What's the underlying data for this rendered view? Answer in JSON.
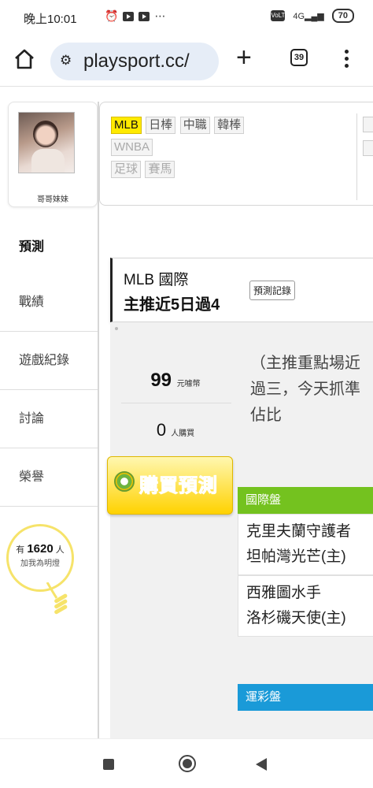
{
  "status_bar": {
    "time": "晚上10:01",
    "extra": "⋯",
    "volte": "VoLTE",
    "network": "4G",
    "battery": "70"
  },
  "browser": {
    "url": "playsport.cc/",
    "tab_count": "39"
  },
  "profile": {
    "name": "哥哥妹妹"
  },
  "leagues": {
    "tags": [
      "MLB",
      "日棒",
      "中職",
      "韓棒"
    ],
    "tags_row2": [
      "WNBA"
    ],
    "tags_row3": [
      "足球",
      "賽馬"
    ],
    "active": "MLB"
  },
  "nav": {
    "items": [
      "預測",
      "戰績",
      "遊戲紀錄",
      "討論",
      "榮譽"
    ]
  },
  "lamp": {
    "prefix": "有",
    "count": "1620",
    "suffix": "人",
    "subtitle": "加我為明燈"
  },
  "prediction": {
    "line1": "MLB 國際",
    "line2": "主推近5日過4",
    "record_button": "預測記錄",
    "price": "99",
    "price_unit": "元噱幣",
    "buyers": "0",
    "buyers_unit": "人購買",
    "buy_button": "購買預測",
    "buy_icon": "coin-icon",
    "analysis": [
      "（主推重點場近",
      "過三，今天抓準",
      "佔比"
    ]
  },
  "table": {
    "international_label": "國際盤",
    "games": [
      {
        "line1": "克里夫蘭守護者",
        "line2": "坦帕灣光芒(主)"
      },
      {
        "line1": "西雅圖水手",
        "line2": "洛杉磯天使(主)"
      }
    ],
    "sports_lottery_label": "運彩盤"
  },
  "colors": {
    "active_tag": "#ffea00",
    "international_header": "#74c21f",
    "lottery_header": "#1a9ad8",
    "buy_text": "#d8230f"
  }
}
